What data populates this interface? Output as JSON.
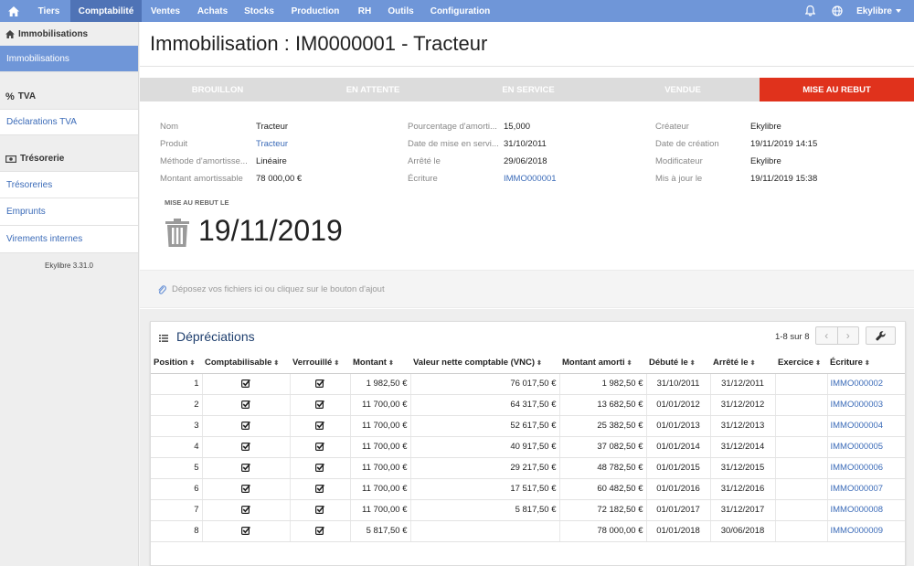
{
  "nav": {
    "items": [
      "Tiers",
      "Comptabilité",
      "Ventes",
      "Achats",
      "Stocks",
      "Production",
      "RH",
      "Outils",
      "Configuration"
    ],
    "active": "Comptabilité",
    "user": "Ekylibre",
    "icons": [
      "home-icon",
      "bell-icon",
      "globe-icon"
    ]
  },
  "sidebar": {
    "sections": [
      {
        "header": "Immobilisations",
        "icon": "home-icon",
        "items": [
          {
            "label": "Immobilisations",
            "active": true
          }
        ]
      },
      {
        "header": "TVA",
        "icon": "percent-icon",
        "items": [
          {
            "label": "Déclarations TVA",
            "active": false
          }
        ]
      },
      {
        "header": "Trésorerie",
        "icon": "money-icon",
        "items": [
          {
            "label": "Trésoreries",
            "active": false
          },
          {
            "label": "Emprunts",
            "active": false
          },
          {
            "label": "Virements internes",
            "active": false
          }
        ]
      }
    ],
    "version": "Ekylibre 3.31.0"
  },
  "page": {
    "title": "Immobilisation : IM0000001 - Tracteur"
  },
  "status_steps": [
    {
      "label": "Brouillon",
      "current": false
    },
    {
      "label": "En attente",
      "current": false
    },
    {
      "label": "En service",
      "current": false
    },
    {
      "label": "Vendue",
      "current": false
    },
    {
      "label": "Mise au rebut",
      "current": true
    }
  ],
  "fields": {
    "col1": [
      {
        "label": "Nom",
        "value": "Tracteur",
        "link": false
      },
      {
        "label": "Produit",
        "value": "Tracteur",
        "link": true
      },
      {
        "label": "Méthode d'amortisse...",
        "value": "Linéaire",
        "link": false
      },
      {
        "label": "Montant amortissable",
        "value": "78 000,00 €",
        "link": false
      }
    ],
    "col2": [
      {
        "label": "Pourcentage d'amorti...",
        "value": "15,000",
        "link": false
      },
      {
        "label": "Date de mise en servi...",
        "value": "31/10/2011",
        "link": false
      },
      {
        "label": "Arrêté le",
        "value": "29/06/2018",
        "link": false
      },
      {
        "label": "Écriture",
        "value": "IMMO000001",
        "link": true
      }
    ],
    "col3": [
      {
        "label": "Créateur",
        "value": "Ekylibre",
        "link": false
      },
      {
        "label": "Date de création",
        "value": "19/11/2019 14:15",
        "link": false
      },
      {
        "label": "Modificateur",
        "value": "Ekylibre",
        "link": false
      },
      {
        "label": "Mis à jour le",
        "value": "19/11/2019 15:38",
        "link": false
      }
    ]
  },
  "scrapped": {
    "label": "Mise au rebut le",
    "date": "19/11/2019"
  },
  "dropzone": {
    "text": "Déposez vos fichiers ici ou cliquez sur le bouton d'ajout"
  },
  "depreciations": {
    "title": "Dépréciations",
    "pager": "1-8 sur 8",
    "columns": [
      "Position",
      "Comptabilisable",
      "Verrouillé",
      "Montant",
      "Valeur nette comptable (VNC)",
      "Montant amorti",
      "Débuté le",
      "Arrêté le",
      "Exercice",
      "Écriture"
    ],
    "rows": [
      {
        "position": "1",
        "accountable": true,
        "locked": true,
        "amount": "1 982,50 €",
        "vnc": "76 017,50 €",
        "depreciated": "1 982,50 €",
        "start": "31/10/2011",
        "stop": "31/12/2011",
        "year": "",
        "entry": "IMMO000002"
      },
      {
        "position": "2",
        "accountable": true,
        "locked": true,
        "amount": "11 700,00 €",
        "vnc": "64 317,50 €",
        "depreciated": "13 682,50 €",
        "start": "01/01/2012",
        "stop": "31/12/2012",
        "year": "",
        "entry": "IMMO000003"
      },
      {
        "position": "3",
        "accountable": true,
        "locked": true,
        "amount": "11 700,00 €",
        "vnc": "52 617,50 €",
        "depreciated": "25 382,50 €",
        "start": "01/01/2013",
        "stop": "31/12/2013",
        "year": "",
        "entry": "IMMO000004"
      },
      {
        "position": "4",
        "accountable": true,
        "locked": true,
        "amount": "11 700,00 €",
        "vnc": "40 917,50 €",
        "depreciated": "37 082,50 €",
        "start": "01/01/2014",
        "stop": "31/12/2014",
        "year": "",
        "entry": "IMMO000005"
      },
      {
        "position": "5",
        "accountable": true,
        "locked": true,
        "amount": "11 700,00 €",
        "vnc": "29 217,50 €",
        "depreciated": "48 782,50 €",
        "start": "01/01/2015",
        "stop": "31/12/2015",
        "year": "",
        "entry": "IMMO000006"
      },
      {
        "position": "6",
        "accountable": true,
        "locked": true,
        "amount": "11 700,00 €",
        "vnc": "17 517,50 €",
        "depreciated": "60 482,50 €",
        "start": "01/01/2016",
        "stop": "31/12/2016",
        "year": "",
        "entry": "IMMO000007"
      },
      {
        "position": "7",
        "accountable": true,
        "locked": true,
        "amount": "11 700,00 €",
        "vnc": "5 817,50 €",
        "depreciated": "72 182,50 €",
        "start": "01/01/2017",
        "stop": "31/12/2017",
        "year": "",
        "entry": "IMMO000008"
      },
      {
        "position": "8",
        "accountable": true,
        "locked": true,
        "amount": "5 817,50 €",
        "vnc": "",
        "depreciated": "78 000,00 €",
        "start": "01/01/2018",
        "stop": "30/06/2018",
        "year": "",
        "entry": "IMMO000009"
      }
    ]
  },
  "colors": {
    "navbar": "#6f96d8",
    "nav_active": "#4f73b6",
    "status_current": "#e0321c",
    "link": "#3b6bb8"
  }
}
